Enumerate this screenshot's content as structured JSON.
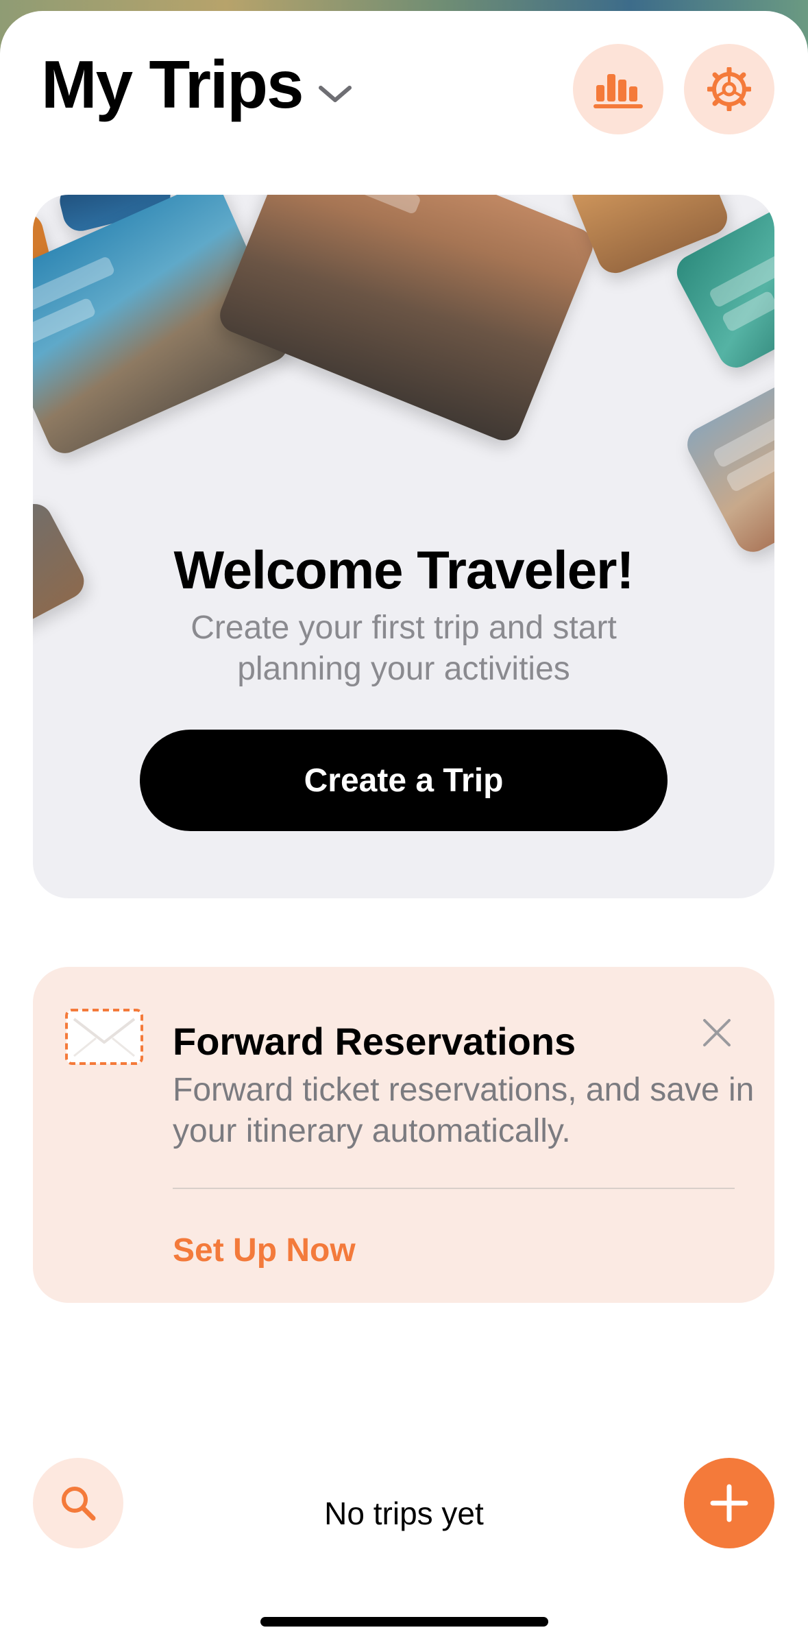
{
  "header": {
    "title": "My Trips"
  },
  "welcome": {
    "title": "Welcome Traveler!",
    "subtitle": "Create your first trip and start planning your activities",
    "button_label": "Create a Trip"
  },
  "forward": {
    "title": "Forward Reservations",
    "description": "Forward ticket reservations, and save in your itinerary automatically.",
    "action_label": "Set Up Now"
  },
  "bottom_bar": {
    "empty_text": "No trips yet"
  },
  "icons": {
    "chevron": "chevron-down-icon",
    "stats": "bar-chart-icon",
    "settings": "gear-icon",
    "envelope": "envelope-icon",
    "close": "close-icon",
    "search": "search-icon",
    "add": "plus-icon"
  },
  "colors": {
    "accent": "#f47a3a",
    "accent_soft": "#fde3d8",
    "card_bg": "#efeff3",
    "promo_bg": "#fbeae3",
    "button_dark": "#000000"
  }
}
